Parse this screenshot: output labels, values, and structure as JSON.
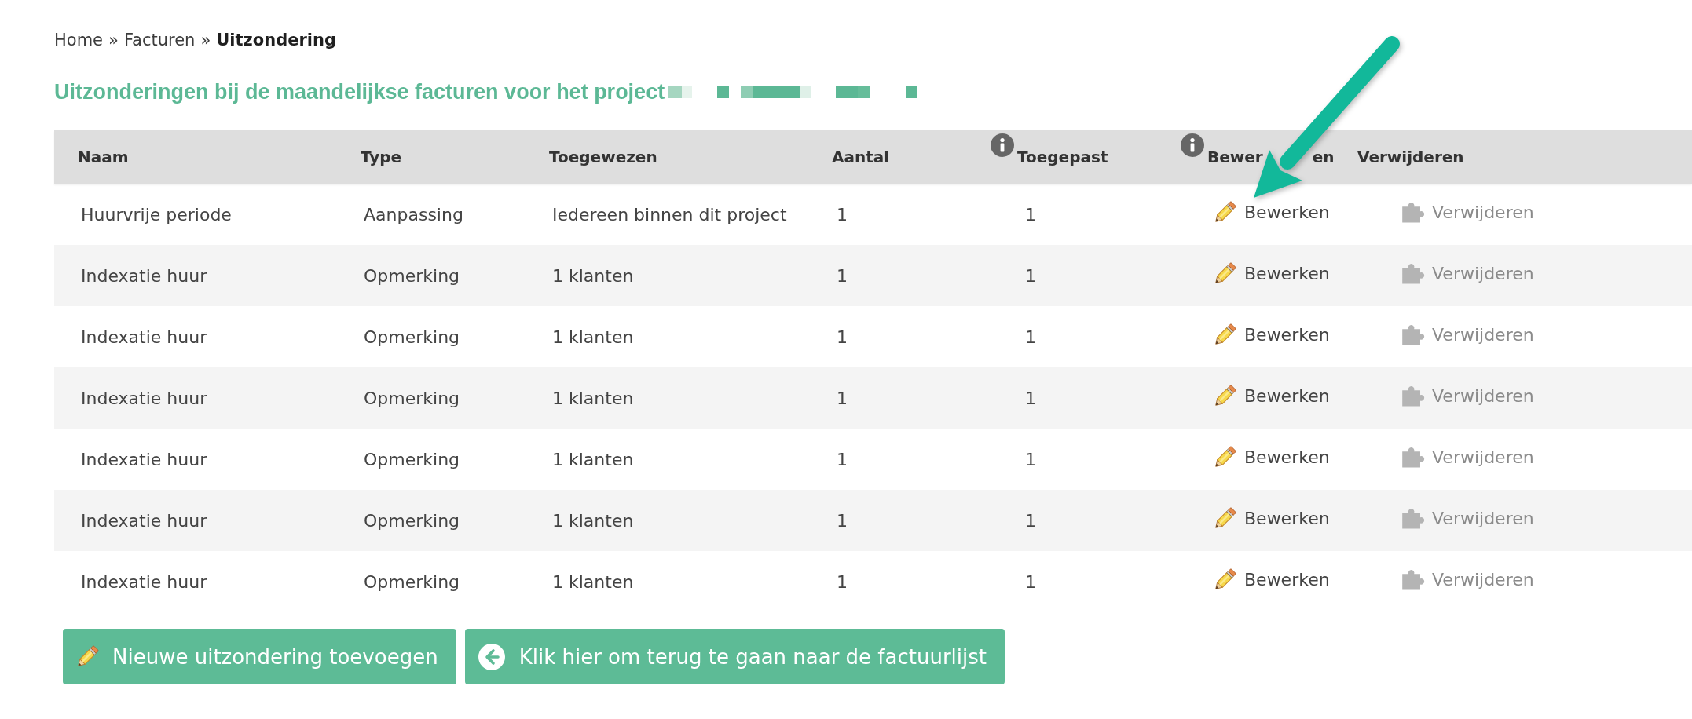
{
  "breadcrumb": [
    {
      "label": "Home",
      "separator": "»",
      "current": false
    },
    {
      "label": "Facturen",
      "separator": "»",
      "current": false
    },
    {
      "label": "Uitzondering",
      "current": true
    }
  ],
  "title": "Uitzonderingen bij de maandelijkse facturen voor het project",
  "table": {
    "columns": [
      {
        "label": "Naam",
        "info": false
      },
      {
        "label": "Type",
        "info": false
      },
      {
        "label": "Toegewezen",
        "info": false
      },
      {
        "label": "Aantal",
        "info": false
      },
      {
        "label": "Toegepast",
        "info": true
      },
      {
        "label_parts": [
          "Bewer",
          "en"
        ],
        "info": true
      },
      {
        "label": "Verwijderen",
        "info": false
      }
    ],
    "rows": [
      {
        "name": "Huurvrije periode",
        "type": "Aanpassing",
        "assigned": "Iedereen binnen dit project",
        "count": "1",
        "applied": "1",
        "edit": "Bewerken",
        "delete": {
          "label": "Verwijderen",
          "disabled": true
        }
      },
      {
        "name": "Indexatie huur",
        "type": "Opmerking",
        "assigned": "1 klanten",
        "count": "1",
        "applied": "1",
        "edit": "Bewerken",
        "delete": {
          "label": "Verwijderen",
          "disabled": true
        }
      },
      {
        "name": "Indexatie huur",
        "type": "Opmerking",
        "assigned": "1 klanten",
        "count": "1",
        "applied": "1",
        "edit": "Bewerken",
        "delete": {
          "label": "Verwijderen",
          "disabled": true
        }
      },
      {
        "name": "Indexatie huur",
        "type": "Opmerking",
        "assigned": "1 klanten",
        "count": "1",
        "applied": "1",
        "edit": "Bewerken",
        "delete": {
          "label": "Verwijderen",
          "disabled": true
        }
      },
      {
        "name": "Indexatie huur",
        "type": "Opmerking",
        "assigned": "1 klanten",
        "count": "1",
        "applied": "1",
        "edit": "Bewerken",
        "delete": {
          "label": "Verwijderen",
          "disabled": true
        }
      },
      {
        "name": "Indexatie huur",
        "type": "Opmerking",
        "assigned": "1 klanten",
        "count": "1",
        "applied": "1",
        "edit": "Bewerken",
        "delete": {
          "label": "Verwijderen",
          "disabled": true
        }
      },
      {
        "name": "Indexatie huur",
        "type": "Opmerking",
        "assigned": "1 klanten",
        "count": "1",
        "applied": "1",
        "edit": "Bewerken",
        "delete": {
          "label": "Verwijderen",
          "disabled": true
        }
      }
    ]
  },
  "buttons": [
    {
      "label": "Nieuwe uitzondering toevoegen",
      "kind": "add"
    },
    {
      "label": "Klik hier om terug te gaan naar de factuurlijst",
      "kind": "back"
    }
  ]
}
